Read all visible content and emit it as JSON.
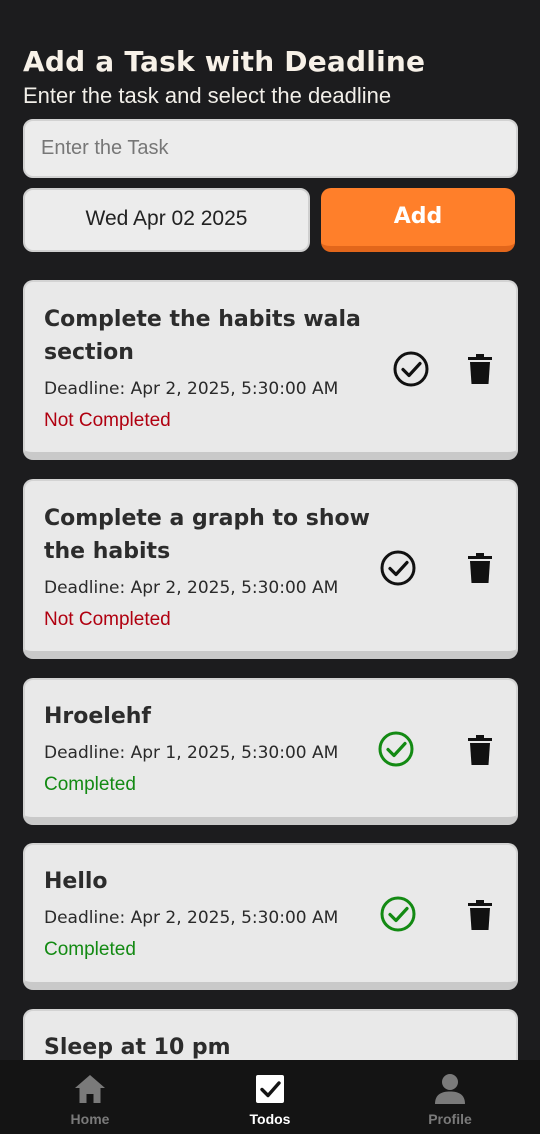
{
  "header": {
    "title": "Add a Task with Deadline",
    "subtitle": "Enter the task and select the deadline"
  },
  "form": {
    "task_placeholder": "Enter the Task",
    "date_value": "Wed Apr 02 2025",
    "add_label": "Add"
  },
  "colors": {
    "background": "#1c1c1e",
    "accent": "#ff7f2a",
    "not_completed": "#b00010",
    "completed": "#138a13"
  },
  "todos": [
    {
      "title": "Complete the habits wala section",
      "deadline": "Deadline: Apr 2, 2025, 5:30:00 AM",
      "status": "Not Completed",
      "completed": false
    },
    {
      "title": "Complete a graph to show the habits",
      "deadline": "Deadline: Apr 2, 2025, 5:30:00 AM",
      "status": "Not Completed",
      "completed": false
    },
    {
      "title": "Hroelehf",
      "deadline": "Deadline: Apr 1, 2025, 5:30:00 AM",
      "status": "Completed",
      "completed": true
    },
    {
      "title": "Hello",
      "deadline": "Deadline: Apr 2, 2025, 5:30:00 AM",
      "status": "Completed",
      "completed": true
    },
    {
      "title": "Sleep at 10 pm"
    }
  ],
  "nav": {
    "items": [
      {
        "label": "Home",
        "icon": "home-icon",
        "active": false
      },
      {
        "label": "Todos",
        "icon": "checkbox-icon",
        "active": true
      },
      {
        "label": "Profile",
        "icon": "user-icon",
        "active": false
      }
    ]
  }
}
